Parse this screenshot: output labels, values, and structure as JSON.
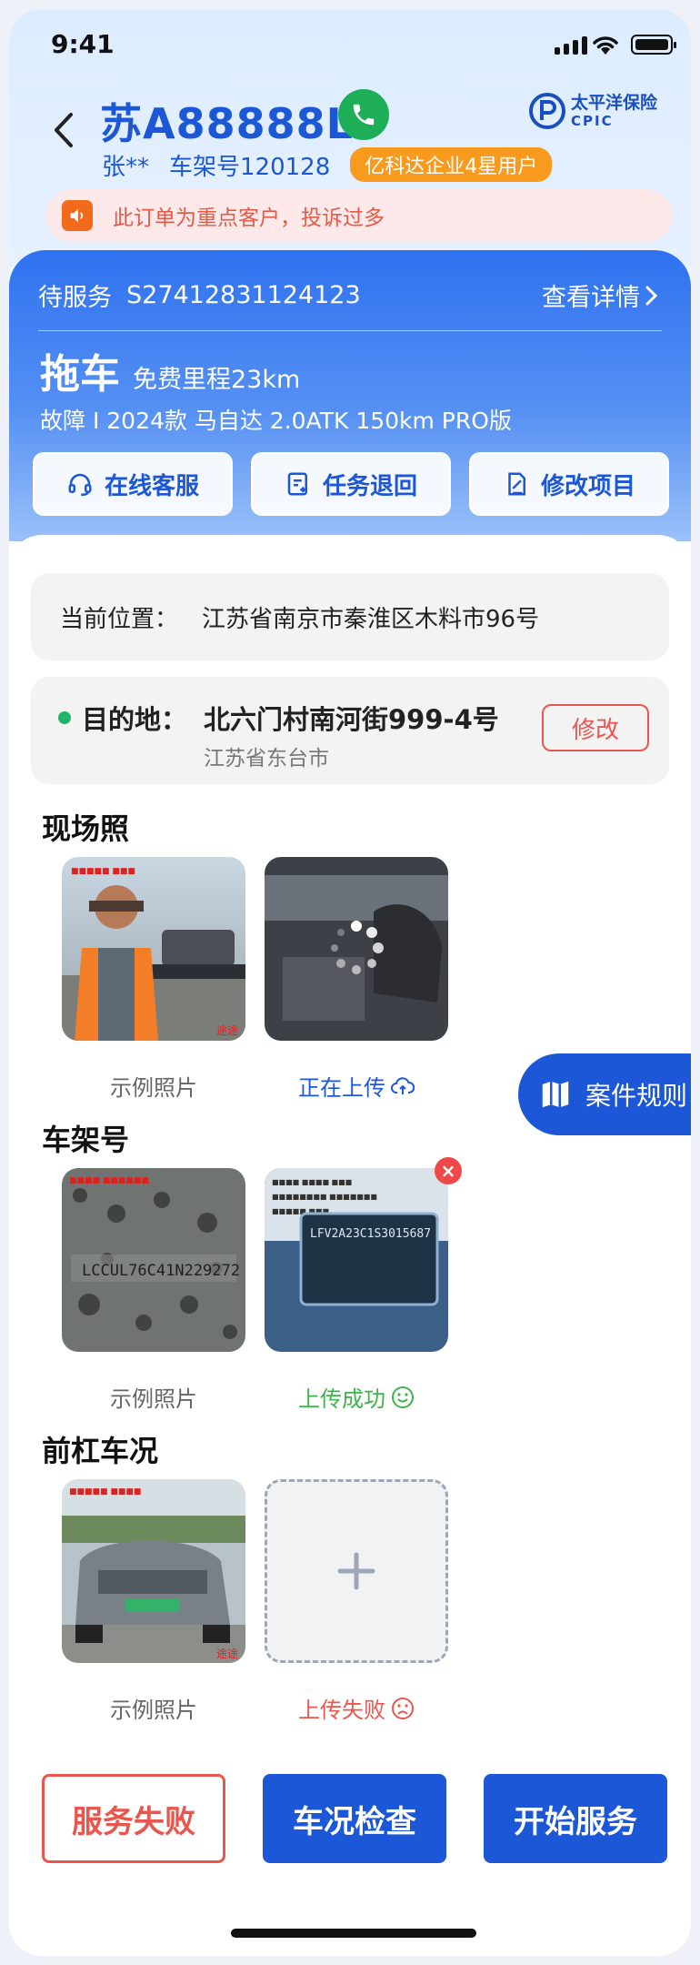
{
  "status_bar": {
    "time": "9:41"
  },
  "header": {
    "plate": "苏A88888L",
    "owner": "张**",
    "vin": "车架号120128",
    "user_tag": "亿科达企业4星用户",
    "insurer_cn": "太平洋保险",
    "insurer_en": "CPIC"
  },
  "alert": {
    "text": "此订单为重点客户，投诉过多"
  },
  "order": {
    "status": "待服务",
    "number": "S27412831124123",
    "detail_link": "查看详情",
    "service": "拖车",
    "mileage": "免费里程23km",
    "vehicle": "故障 I 2024款 马自达 2.0ATK 150km PRO版"
  },
  "actions": [
    {
      "label": "在线客服",
      "icon": "headset-icon"
    },
    {
      "label": "任务退回",
      "icon": "return-icon"
    },
    {
      "label": "修改项目",
      "icon": "edit-icon"
    }
  ],
  "location": {
    "current_label": "当前位置：",
    "current": "江苏省南京市秦淮区木料市96号",
    "dest_label": "目的地：",
    "dest": "北六门村南河街999-4号",
    "dest_city": "江苏省东台市",
    "edit": "修改"
  },
  "sections": {
    "scene": {
      "title": "现场照",
      "sample": "示例照片",
      "status": "正在上传"
    },
    "vin": {
      "title": "车架号",
      "sample": "示例照片",
      "status": "上传成功",
      "vin_text_sample": "LCCUL76C41N229272",
      "vin_text_upload": "LFV2A23C1S3015687"
    },
    "front": {
      "title": "前杠车况",
      "sample": "示例照片",
      "status": "上传失败"
    },
    "watermark": "途途"
  },
  "case_rule": {
    "label": "案件规则"
  },
  "bottom": {
    "fail": "服务失败",
    "check": "车况检查",
    "start": "开始服务"
  },
  "colors": {
    "primary": "#1b57d6",
    "danger": "#e8564e",
    "success": "#3cb64a",
    "warning": "#f79a1e"
  }
}
